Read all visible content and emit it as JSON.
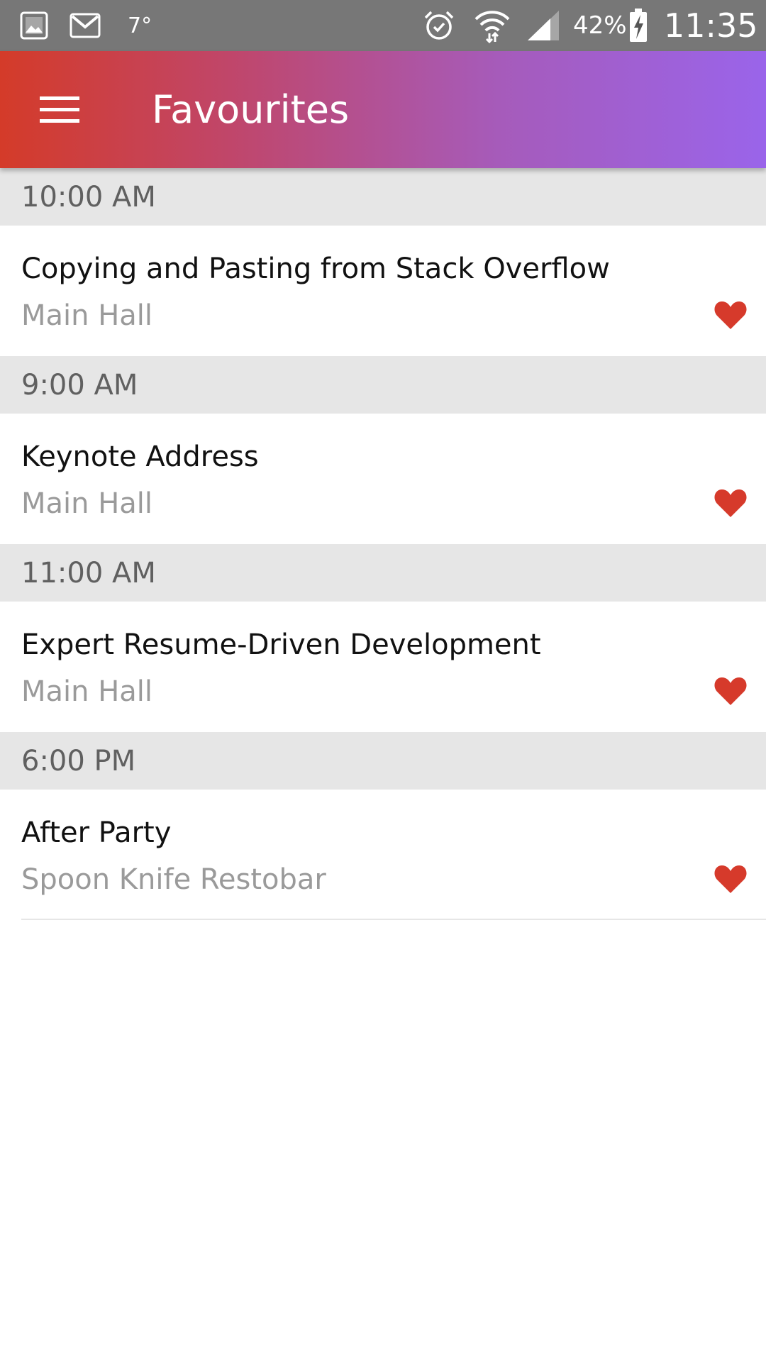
{
  "status_bar": {
    "icons": [
      "gallery-icon",
      "gmail-icon",
      "alarm-icon",
      "wifi-icon",
      "cell-signal-icon",
      "battery-charging-icon"
    ],
    "temperature": "7°",
    "battery_percent": "42%",
    "time": "11:35"
  },
  "app_bar": {
    "title": "Favourites",
    "menu_icon": "hamburger-menu-icon",
    "gradient": [
      "#d43b29",
      "#9a64ea"
    ]
  },
  "sections": [
    {
      "time": "10:00 AM",
      "sessions": [
        {
          "title": "Copying and Pasting from Stack Overflow",
          "room": "Main Hall",
          "favourite": true
        }
      ]
    },
    {
      "time": "9:00 AM",
      "sessions": [
        {
          "title": "Keynote Address",
          "room": "Main Hall",
          "favourite": true
        }
      ]
    },
    {
      "time": "11:00 AM",
      "sessions": [
        {
          "title": "Expert Resume-Driven Development",
          "room": "Main Hall",
          "favourite": true
        }
      ]
    },
    {
      "time": "6:00 PM",
      "sessions": [
        {
          "title": "After Party",
          "room": "Spoon Knife Restobar",
          "favourite": true
        }
      ]
    }
  ],
  "colors": {
    "heart": "#d63a2b",
    "section_bg": "#e6e6e6",
    "status_bar": "#777777"
  }
}
